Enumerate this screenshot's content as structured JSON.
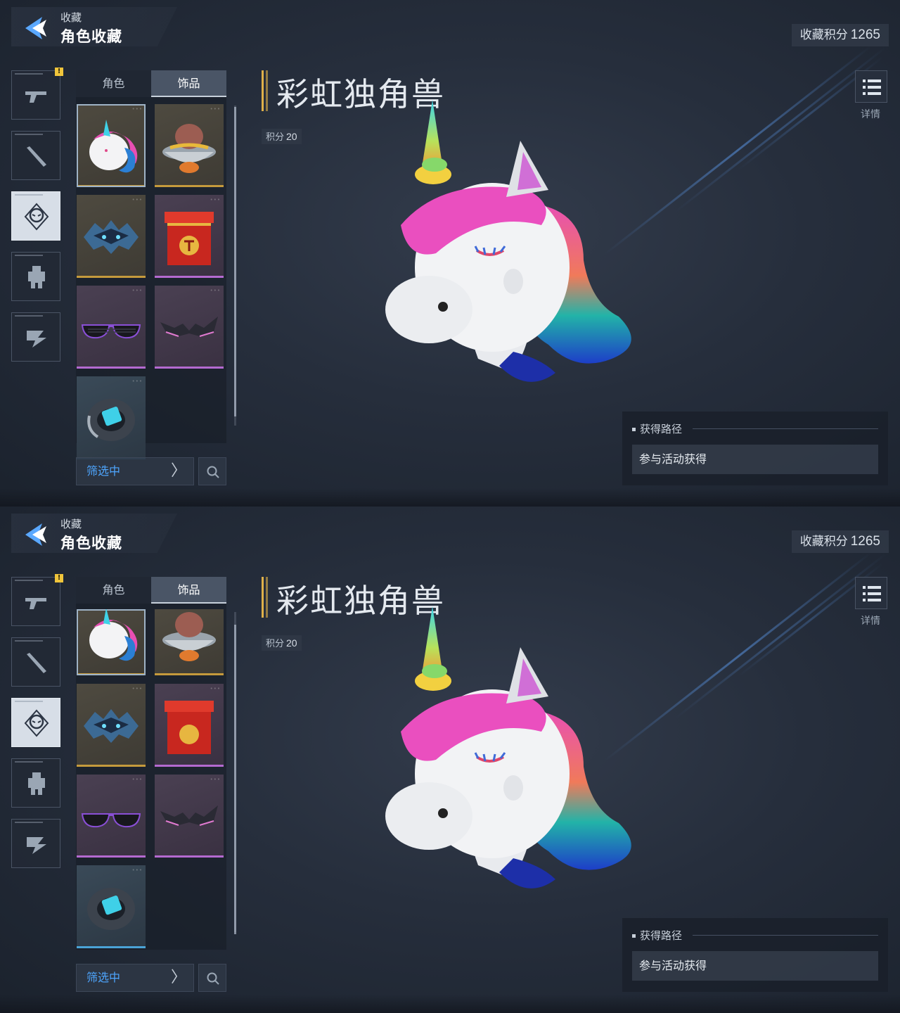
{
  "header": {
    "breadcrumb": "收藏",
    "title": "角色收藏"
  },
  "points": {
    "label": "收藏积分",
    "value": "1265"
  },
  "categories": [
    {
      "name": "gun-icon",
      "active": false,
      "badge": "!"
    },
    {
      "name": "melee-weapon-icon",
      "active": false
    },
    {
      "name": "mask-icon",
      "active": true
    },
    {
      "name": "robot-icon",
      "active": false
    },
    {
      "name": "vehicle-icon",
      "active": false
    }
  ],
  "tabs": {
    "characters": "角色",
    "accessories": "饰品"
  },
  "items": [
    {
      "name": "rainbow-unicorn-head",
      "rarity": "gold"
    },
    {
      "name": "capybara-noodle-bowl",
      "rarity": "gold"
    },
    {
      "name": "ice-dragon-mask",
      "rarity": "gold"
    },
    {
      "name": "red-gift-box",
      "rarity": "purple"
    },
    {
      "name": "shutter-sunglasses",
      "rarity": "purple"
    },
    {
      "name": "bat-wing-glasses",
      "rarity": "purple"
    },
    {
      "name": "cyber-armband",
      "rarity": "blue"
    }
  ],
  "filter": {
    "label": "筛选中"
  },
  "detail": {
    "item_name": "彩虹独角兽",
    "score_label": "积分",
    "score_value": "20",
    "info_label": "详情",
    "source_heading": "获得路径",
    "source_text": "参与活动获得"
  },
  "colors": {
    "accent_gold": "#e0b14a",
    "filter_blue": "#4ea6ff",
    "rarity_gold": "#c59a3c",
    "rarity_purple": "#b46ad0",
    "rarity_blue": "#4aa3d6"
  }
}
